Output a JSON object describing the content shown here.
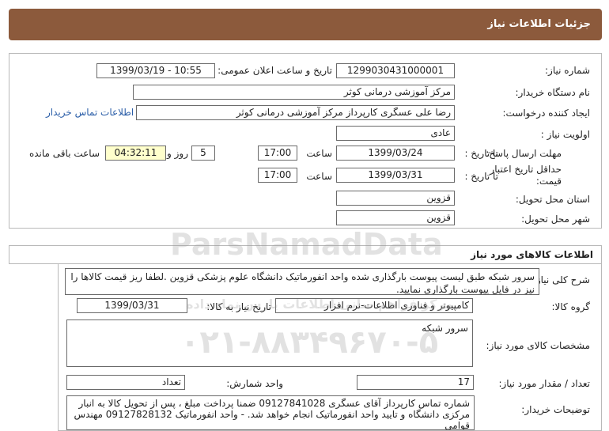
{
  "header": {
    "title": "جزئیات اطلاعات نیاز"
  },
  "need_info": {
    "need_number_label": "شماره نیاز:",
    "need_number": "1299030431000001",
    "announce_label": "تاریخ و ساعت اعلان عمومی:",
    "announce_value": "1399/03/19 - 10:55",
    "buyer_org_label": "نام دستگاه خریدار:",
    "buyer_org": "مرکز آموزشی درمانی کوثر",
    "creator_label": "ایجاد کننده درخواست:",
    "creator": "رضا علی عسگری کارپرداز مرکز آموزشی درمانی کوثر",
    "contact_link": "اطلاعات تماس خریدار",
    "priority_label": "اولویت نیاز :",
    "priority": "عادی",
    "deadline_label": "مهلت ارسال پاسخ:",
    "to_date_label": "تا تاریخ :",
    "deadline_date": "1399/03/24",
    "time_label": "ساعت",
    "deadline_time": "17:00",
    "days_value": "5",
    "days_label": "روز و",
    "remaining_time": "04:32:11",
    "remaining_label": "ساعت باقی مانده",
    "validity_label_1": "حداقل تاریخ اعتبار",
    "validity_label_2": "قیمت:",
    "validity_to_label": "تا تاریخ :",
    "validity_date": "1399/03/31",
    "validity_time_label": "ساعت",
    "validity_time": "17:00",
    "province_label": "استان محل تحویل:",
    "province": "قزوین",
    "city_label": "شهر محل تحویل:",
    "city": "قزوین"
  },
  "goods": {
    "section_title": "اطلاعات کالاهای مورد نیاز",
    "summary_label": "شرح کلی نیاز:",
    "summary": "سرور شبکه طبق لیست پیوست بارگذاری شده واحد انفورماتیک دانشگاه علوم پزشکی قزوین .لطفا ریز قیمت کالاها را نیز در فایل پیوست بارگذاری نمایید.",
    "group_label": "گروه کالا:",
    "group": "کامپیوتر و فناوری اطلاعات-نرم افزار",
    "need_date_label": "تاریخ نیاز به کالا:",
    "need_date": "1399/03/31",
    "spec_label": "مشخصات کالای مورد نیاز:",
    "spec": "سرور شبکه",
    "qty_label": "تعداد / مقدار مورد نیاز:",
    "qty": "17",
    "unit_label": "واحد شمارش:",
    "unit": "تعداد",
    "notes_label": "توضیحات خریدار:",
    "notes": "شماره تماس کارپرداز آقای عسگری 09127841028 ضمنا پرداخت مبلغ ، پس از تحویل کالا به انبار مرکزی دانشگاه و تایید واحد انفورماتیک  انجام خواهد شد. - واحد انفورماتیک 09127828132 مهندس قوامی"
  },
  "watermark": {
    "brand": "ParsNamadData",
    "brand_fa": "مرکز فراهم سانی اطلاعات پارس نماد داده",
    "phone": "۰۲۱-۸۸۳۴۹۶۷۰-۵"
  },
  "colors": {
    "header_bg": "#8c5a3c",
    "remaining_bg": "#ffffcc",
    "link": "#2b5ea8"
  }
}
